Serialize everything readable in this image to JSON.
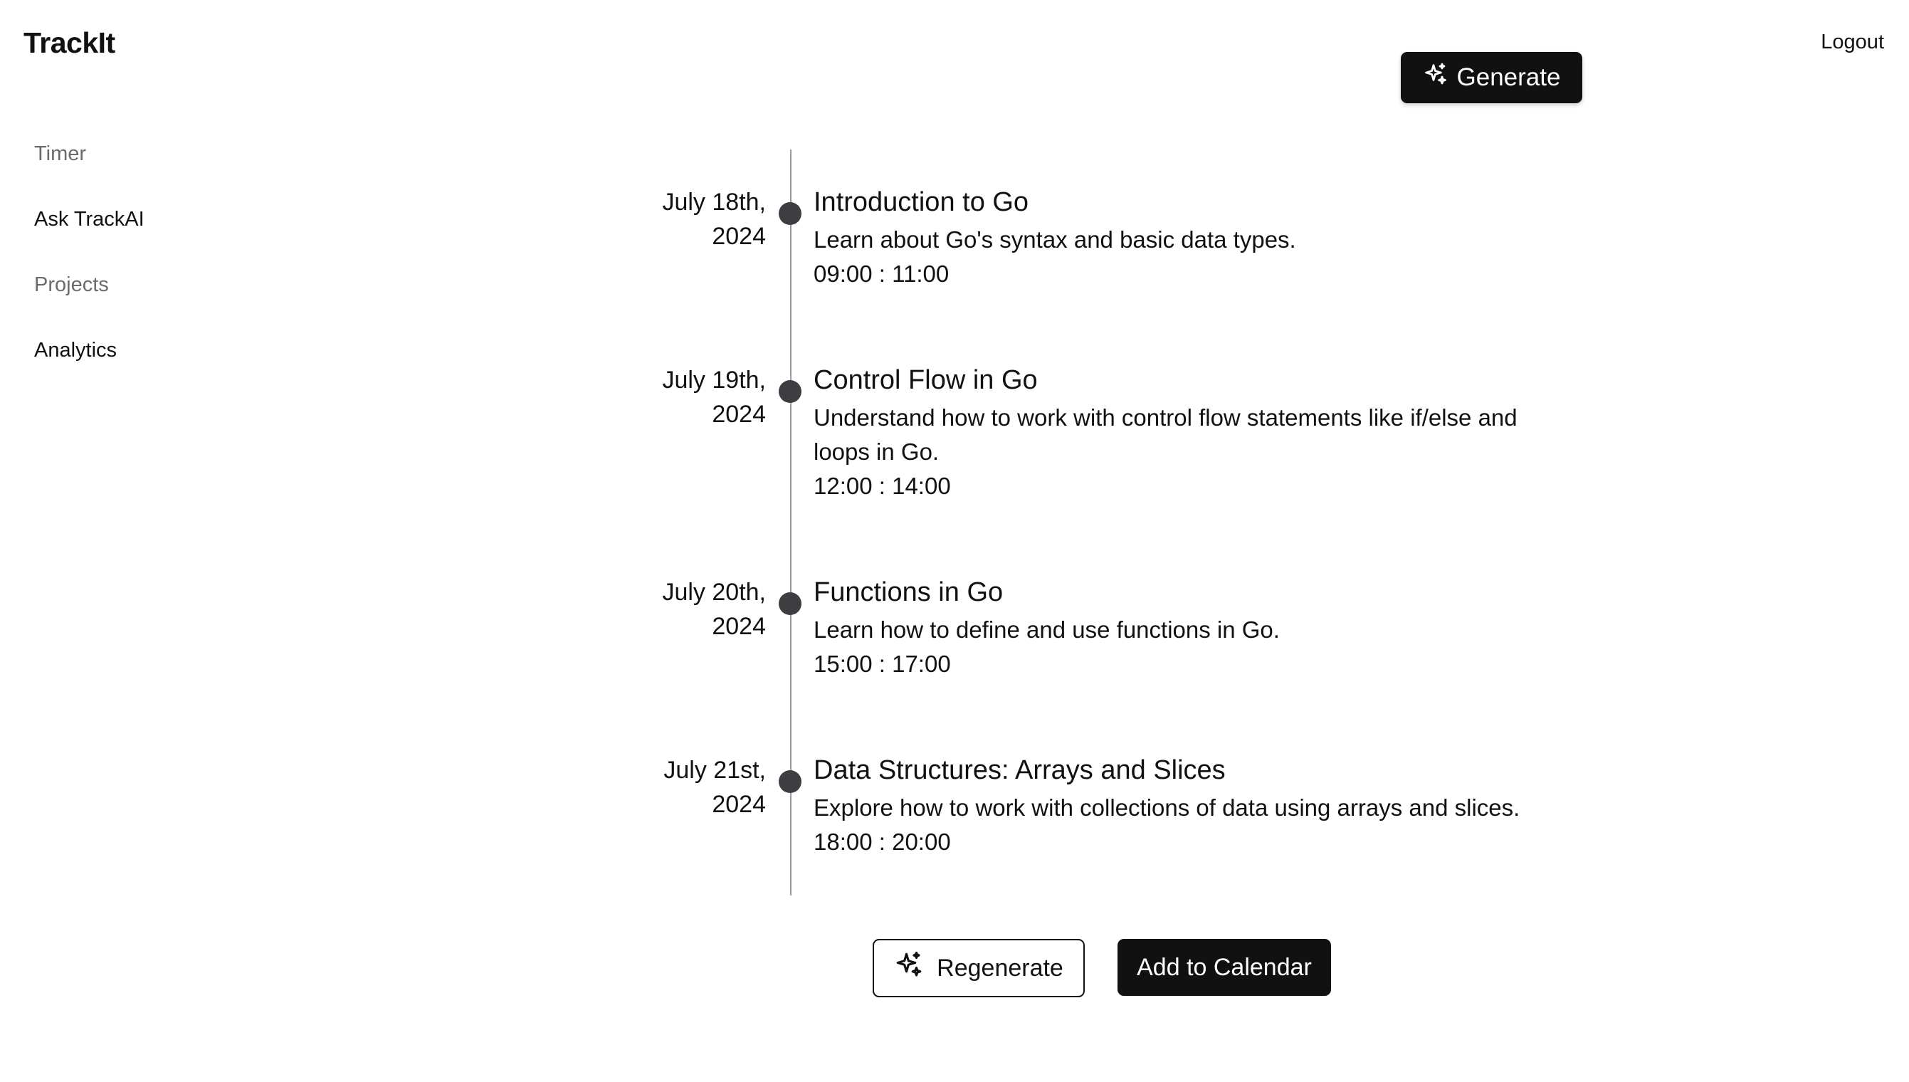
{
  "app": {
    "brand": "TrackIt"
  },
  "header": {
    "logout_label": "Logout",
    "generate_label": "Generate"
  },
  "sidebar": {
    "items": [
      {
        "label": "Timer"
      },
      {
        "label": "Ask TrackAI"
      },
      {
        "label": "Projects"
      },
      {
        "label": "Analytics"
      }
    ]
  },
  "timeline": {
    "events": [
      {
        "date_line1": "July 18th,",
        "date_line2": "2024",
        "title": "Introduction to Go",
        "description": "Learn about Go's syntax and basic data types.",
        "time": "09:00 : 11:00"
      },
      {
        "date_line1": "July 19th,",
        "date_line2": "2024",
        "title": "Control Flow in Go",
        "description": "Understand how to work with control flow statements like if/else and loops in Go.",
        "time": "12:00 : 14:00"
      },
      {
        "date_line1": "July 20th,",
        "date_line2": "2024",
        "title": "Functions in Go",
        "description": "Learn how to define and use functions in Go.",
        "time": "15:00 : 17:00"
      },
      {
        "date_line1": "July 21st,",
        "date_line2": "2024",
        "title": "Data Structures: Arrays and Slices",
        "description": "Explore how to work with collections of data using arrays and slices.",
        "time": "18:00 : 20:00"
      }
    ]
  },
  "actions": {
    "regenerate_label": "Regenerate",
    "add_calendar_label": "Add to Calendar"
  },
  "icons": {
    "generate": "sparkles-icon",
    "regenerate": "sparkles-icon"
  },
  "colors": {
    "primary": "#111111",
    "muted_text": "#6b6b6b",
    "timeline_line": "#9a9a9a",
    "timeline_dot": "#3d3d42"
  }
}
